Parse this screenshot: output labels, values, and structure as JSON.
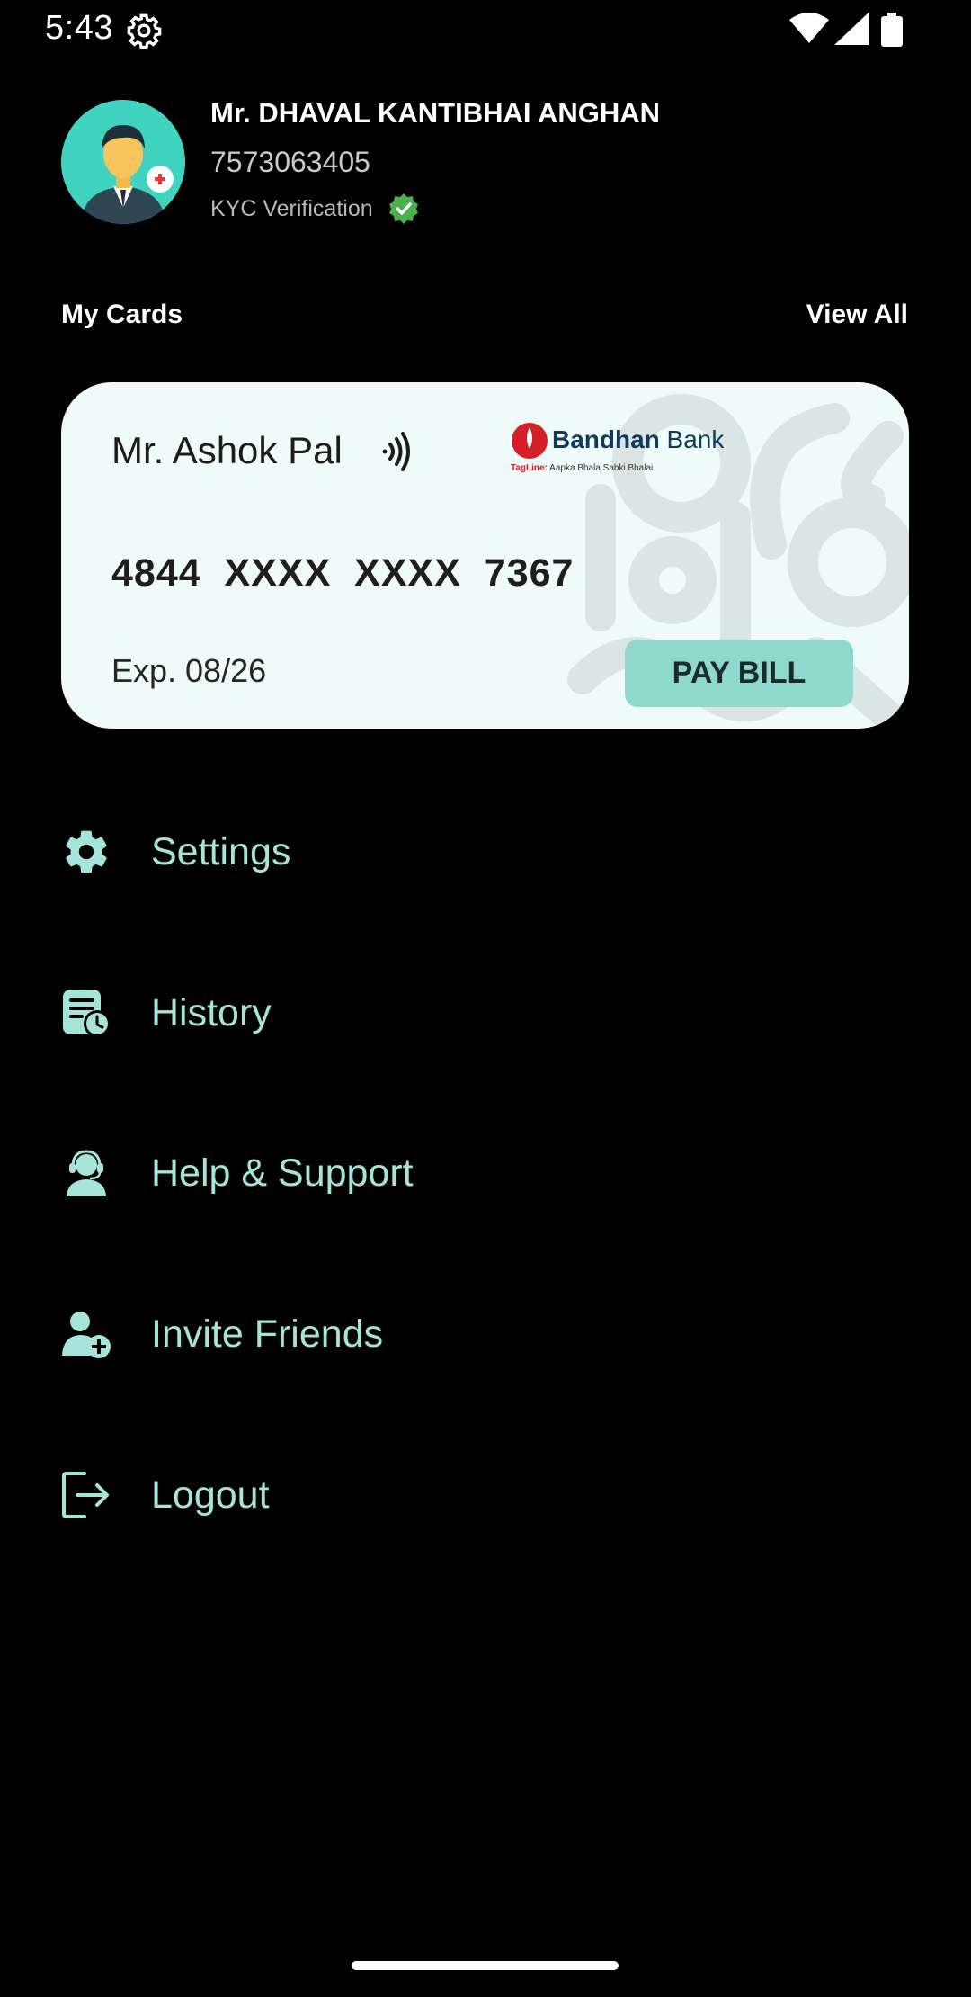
{
  "status_bar": {
    "time": "5:43",
    "icons": [
      "settings-gear-icon",
      "wifi-icon",
      "signal-icon",
      "battery-icon"
    ]
  },
  "profile": {
    "name": "Mr. DHAVAL KANTIBHAI ANGHAN",
    "phone": "7573063405",
    "kyc_label": "KYC Verification",
    "kyc_verified": true
  },
  "cards_section": {
    "title": "My Cards",
    "view_all_label": "View All"
  },
  "card": {
    "holder_name": "Mr. Ashok Pal",
    "bank_name_bold": "Bandhan",
    "bank_name_light": " Bank",
    "tagline_label": "TagLine:",
    "tagline_text": "Aapka Bhala Sabki Bhalai",
    "number": "4844  XXXX  XXXX  7367",
    "expiry": "Exp. 08/26",
    "pay_bill_label": "PAY BILL",
    "background_color": "#effbf9",
    "button_color": "#8fd8cc"
  },
  "menu": [
    {
      "label": "Settings",
      "icon": "gear-icon"
    },
    {
      "label": "History",
      "icon": "history-icon"
    },
    {
      "label": "Help & Support",
      "icon": "support-agent-icon"
    },
    {
      "label": "Invite Friends",
      "icon": "add-user-icon"
    },
    {
      "label": "Logout",
      "icon": "logout-icon"
    }
  ],
  "colors": {
    "background": "#000000",
    "menu_accent": "#a6e3d8",
    "verified_green": "#4caf50"
  }
}
